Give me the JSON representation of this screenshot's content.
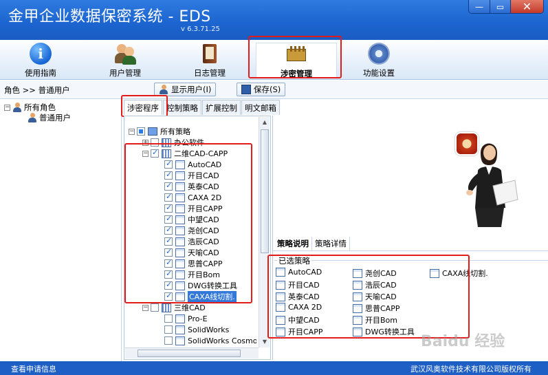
{
  "app": {
    "title": "金甲企业数据保密系统 - EDS",
    "version": "v 6.3.71.25"
  },
  "window_controls": {
    "minimize": "—",
    "maximize": "▭",
    "close": "✕"
  },
  "nav": [
    {
      "label": "使用指南",
      "icon": "info-icon"
    },
    {
      "label": "用户管理",
      "icon": "users-icon"
    },
    {
      "label": "日志管理",
      "icon": "log-book-icon"
    },
    {
      "label": "涉密管理",
      "icon": "secret-manage-icon",
      "active": true
    },
    {
      "label": "功能设置",
      "icon": "gear-icon"
    }
  ],
  "toolbar": {
    "breadcrumb": "角色 >> 普通用户",
    "show_users": "显示用户(I)",
    "save": "保存(S)"
  },
  "role_tree": {
    "root": "所有角色",
    "child": "普通用户"
  },
  "tabs": [
    "涉密程序",
    "控制策略",
    "扩展控制",
    "明文邮箱"
  ],
  "policy_tree": {
    "root": "所有策略",
    "groups": [
      {
        "label": "办公软件",
        "state": "unchecked"
      },
      {
        "label": "二维CAD-CAPP",
        "state": "checked",
        "items": [
          "AutoCAD",
          "开目CAD",
          "英泰CAD",
          "CAXA 2D",
          "开目CAPP",
          "中望CAD",
          "尧创CAD",
          "浩辰CAD",
          "天喻CAD",
          "思普CAPP",
          "开目Bom",
          "DWG转换工具",
          "CAXA线切割."
        ]
      },
      {
        "label": "三维CAD",
        "state": "unchecked",
        "items": [
          "Pro-E",
          "SolidWorks",
          "SolidWorks Cosmo"
        ]
      }
    ]
  },
  "right_panel": {
    "subtabs": [
      "策略说明",
      "策略详情"
    ],
    "selected_label": "已选策略",
    "selected_col1": [
      "AutoCAD",
      "开目CAD",
      "英泰CAD",
      "CAXA 2D",
      "中望CAD",
      "开目CAPP"
    ],
    "selected_col2": [
      "尧创CAD",
      "浩辰CAD",
      "天喻CAD",
      "思普CAPP",
      "开目Bom",
      "DWG转换工具"
    ],
    "selected_col3": [
      "CAXA线切割."
    ]
  },
  "status": {
    "left": "查看申请信息",
    "right": "武汉风奥软件技术有限公司版权所有"
  },
  "watermark": "Baidu 经验",
  "colors": {
    "titlebar": "#1c64cf",
    "highlight_box": "#e31b1b",
    "selection": "#3178d8"
  }
}
